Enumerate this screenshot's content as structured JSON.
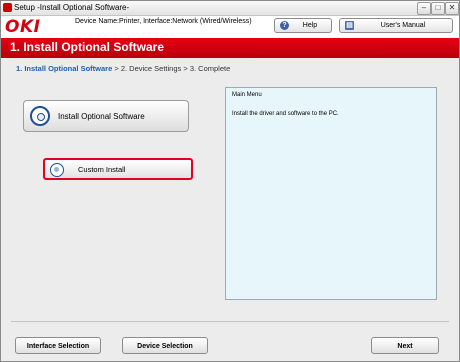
{
  "window": {
    "title": "Setup -Install Optional Software-",
    "controls": [
      "–",
      "□",
      "✕"
    ]
  },
  "header": {
    "logo": "OKI",
    "device_name": "Device Name:Printer, Interface:Network (Wired/Wireless)",
    "help_label": "Help",
    "manual_label": "User's Manual"
  },
  "banner": {
    "title": "1. Install Optional Software"
  },
  "steps": {
    "current": "1. Install Optional Software",
    "rest": " > 2. Device Settings > 3. Complete"
  },
  "main": {
    "install_button_label": "Install Optional Software",
    "custom_button_label": "Custom Install"
  },
  "info_panel": {
    "title": "Main Menu",
    "text": "Install the driver and software to the PC."
  },
  "footer": {
    "interface_label": "Interface Selection",
    "device_label": "Device Selection",
    "next_label": "Next"
  },
  "colors": {
    "brand_red": "#d7000f",
    "banner_red": "#e60012",
    "step_active": "#1f5fa8",
    "panel_bg": "#e6f6fa"
  },
  "icons": {
    "help": "question-icon",
    "manual": "book-icon",
    "install": "disc-icon",
    "custom": "disc-icon"
  }
}
